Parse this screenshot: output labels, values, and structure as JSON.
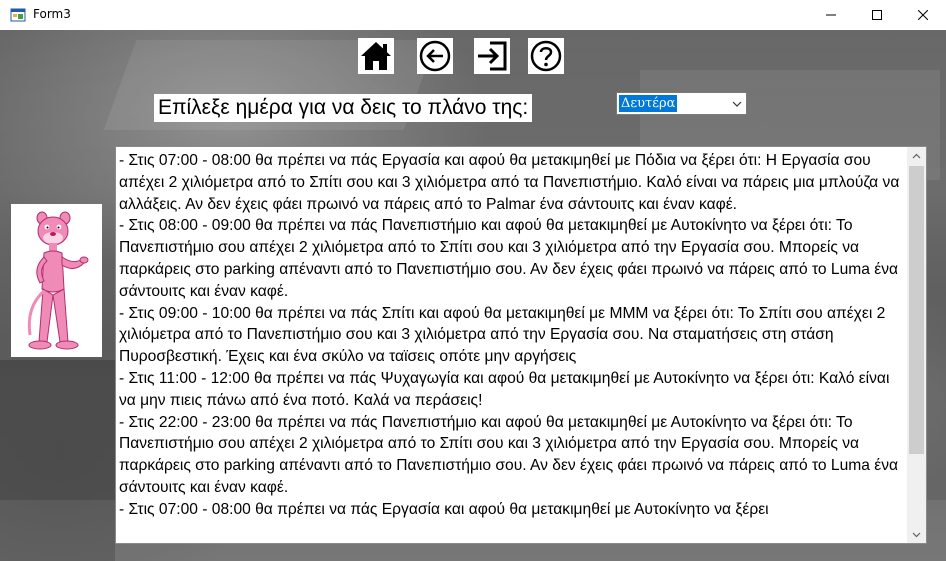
{
  "window": {
    "title": "Form3"
  },
  "toolbar": {
    "home_icon": "home-icon",
    "back_icon": "arrow-left-circle-icon",
    "exit_icon": "sign-in-icon",
    "help_icon": "question-circle-icon"
  },
  "prompt": {
    "label": "Επίλεξε ημέρα για να δεις το πλάνο της:"
  },
  "day_select": {
    "value": "Δευτέρα"
  },
  "plan": {
    "text": "- Στις 07:00 - 08:00 θα πρέπει να πάς Εργασία και αφού θα μετακιμηθεί με Πόδια να ξέρει ότι: Η Εργασία σου απέχει 2 χιλιόμετρα από το Σπίτι σου και 3 χιλιόμετρα από τα Πανεπιστήμιο. Καλό είναι να πάρεις μια μπλούζα να αλλάξεις. Αν δεν έχεις φάει πρωινό να πάρεις από το Palmar ένα σάντουιτς και έναν καφέ.\n- Στις 08:00 - 09:00 θα πρέπει να πάς Πανεπιστήμιο και αφού θα μετακιμηθεί με Αυτοκίνητο να ξέρει ότι: Το Πανεπιστήμιο σου απέχει 2 χιλιόμετρα από το Σπίτι σου και 3 χιλιόμετρα από την Εργασία σου. Μπορείς να παρκάρεις στο parking απέναντι από το Πανεπιστήμιο σου. Αν δεν έχεις φάει πρωινό να πάρεις από το Luma ένα σάντουιτς και έναν καφέ.\n- Στις 09:00 - 10:00 θα πρέπει να πάς Σπίτι και αφού θα μετακιμηθεί με ΜΜΜ να ξέρει ότι: Το Σπίτι σου απέχει 2 χιλιόμετρα από το Πανεπιστήμιο σου και 3 χιλιόμετρα από την Εργασία σου. Να σταματήσεις στη στάση Πυροσβεστική. Έχεις και ένα σκύλο να ταϊσεις οπότε μην αργήσεις\n- Στις 11:00 - 12:00 θα πρέπει να πάς Ψυχαγωγία και αφού θα μετακιμηθεί με Αυτοκίνητο να ξέρει ότι: Καλό είναι να μην πιεις πάνω από ένα ποτό. Καλά να περάσεις!\n- Στις 22:00 - 23:00 θα πρέπει να πάς Πανεπιστήμιο και αφού θα μετακιμηθεί με Αυτοκίνητο να ξέρει ότι: Το Πανεπιστήμιο σου απέχει 2 χιλιόμετρα από το Σπίτι σου και 3 χιλιόμετρα από την Εργασία σου. Μπορείς να παρκάρεις στο parking απέναντι από το Πανεπιστήμιο σου. Αν δεν έχεις φάει πρωινό να πάρεις από το Luma ένα σάντουιτς και έναν καφέ.\n- Στις 07:00 - 08:00 θα πρέπει να πάς Εργασία και αφού θα μετακιμηθεί με Αυτοκίνητο να ξέρει"
  },
  "colors": {
    "selection": "#0078d7",
    "avatar_pink": "#f08bb8"
  }
}
